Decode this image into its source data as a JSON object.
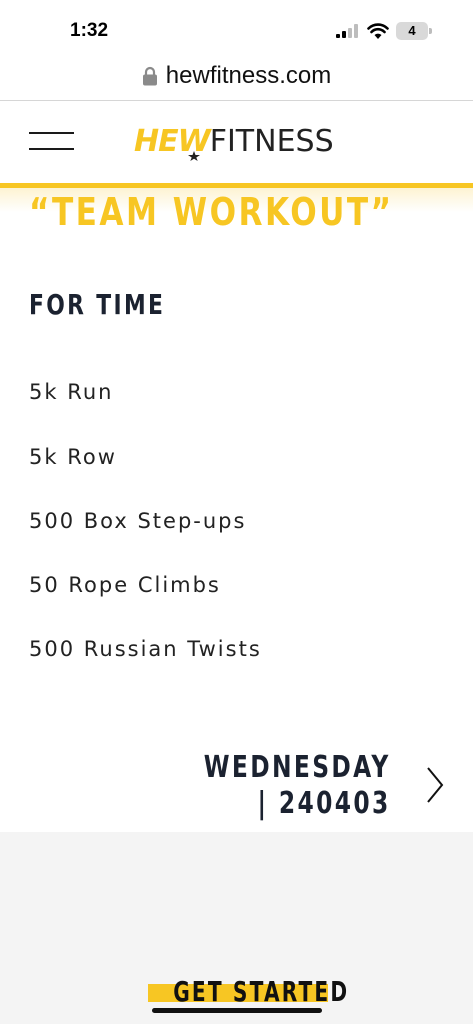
{
  "status_bar": {
    "time": "1:32",
    "battery_level": "4"
  },
  "browser": {
    "url": "hewfitness.com"
  },
  "header": {
    "logo_primary": "HEW",
    "logo_secondary": "FITNESS",
    "accent_color": "#f7c623"
  },
  "workout": {
    "title": "“TEAM WORKOUT”",
    "format": "FOR TIME",
    "exercises": [
      "5k Run",
      "5k Row",
      "500 Box Step-ups",
      "50 Rope Climbs",
      "500 Russian Twists"
    ]
  },
  "date_nav": {
    "day": "WEDNESDAY",
    "code": "| 240403"
  },
  "cta": {
    "label": "GET STARTED"
  }
}
